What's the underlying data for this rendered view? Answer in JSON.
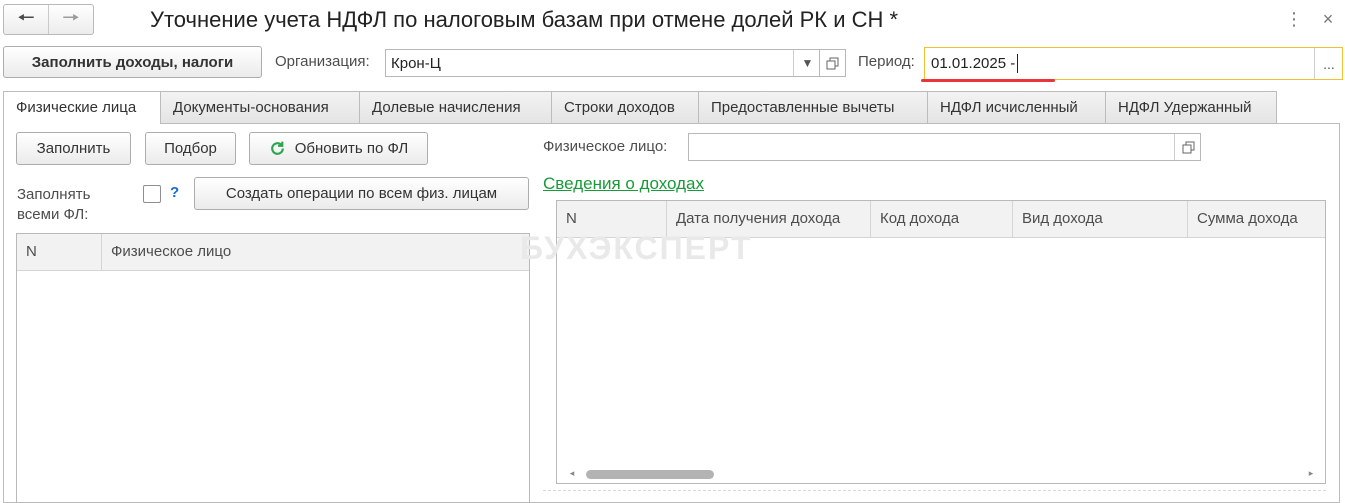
{
  "window": {
    "title": "Уточнение учета НДФЛ по налоговым базам при отмене долей РК и СН *",
    "more_glyph": "⋮",
    "close_glyph": "×"
  },
  "nav": {
    "back_glyph": "🠔",
    "forward_glyph": "🠖"
  },
  "toolbar": {
    "fill_button": "Заполнить доходы, налоги",
    "org_label": "Организация:",
    "org_value": "Крон-Ц",
    "period_label": "Период:",
    "period_value": "01.01.2025 - ",
    "ellipsis": "..."
  },
  "tabs": [
    {
      "label": "Физические лица"
    },
    {
      "label": "Документы-основания"
    },
    {
      "label": "Долевые начисления"
    },
    {
      "label": "Строки доходов"
    },
    {
      "label": "Предоставленные вычеты"
    },
    {
      "label": "НДФЛ исчисленный"
    },
    {
      "label": "НДФЛ Удержанный"
    }
  ],
  "left": {
    "fill_btn": "Заполнить",
    "pick_btn": "Подбор",
    "refresh_btn": "Обновить по ФЛ",
    "fill_all_label": "Заполнять всеми ФЛ:",
    "help": "?",
    "create_btn": "Создать операции по всем физ. лицам",
    "columns": [
      "N",
      "Физическое лицо"
    ]
  },
  "right": {
    "person_label": "Физическое лицо:",
    "person_value": "",
    "section_link": "Сведения о доходах",
    "columns": [
      "N",
      "Дата получения дохода",
      "Код дохода",
      "Вид дохода",
      "Сумма дохода"
    ]
  },
  "watermark": "БУХЭКСПЕРТ",
  "colors": {
    "accent_link": "#199a3a",
    "active_field_border": "#f2c033",
    "underline": "#e8343a"
  }
}
